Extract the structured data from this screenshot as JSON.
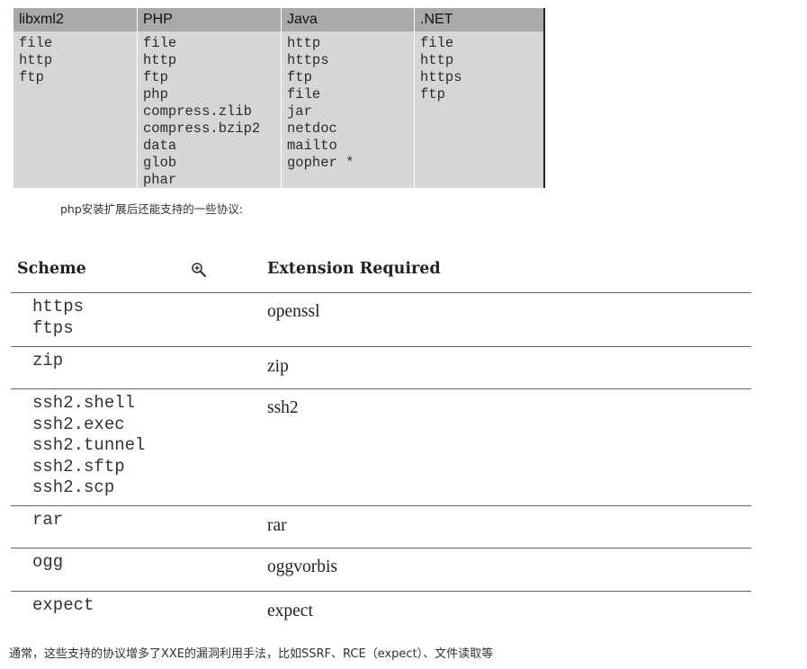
{
  "protocol_table": {
    "headers": [
      "libxml2",
      "PHP",
      "Java",
      ".NET"
    ],
    "columns": [
      [
        "file",
        "http",
        "ftp"
      ],
      [
        "file",
        "http",
        "ftp",
        "php",
        "compress.zlib",
        "compress.bzip2",
        "data",
        "glob",
        "phar"
      ],
      [
        "http",
        "https",
        "ftp",
        "file",
        "jar",
        "netdoc",
        "mailto",
        "gopher *"
      ],
      [
        "file",
        "http",
        "https",
        "ftp"
      ]
    ]
  },
  "caption": "php安装扩展后还能支持的一些协议:",
  "scheme_table": {
    "header_scheme": "Scheme",
    "header_extension": "Extension Required",
    "zoom_icon": "zoom-in-icon",
    "rows": [
      {
        "schemes": [
          "https",
          "ftps"
        ],
        "extension": "openssl"
      },
      {
        "schemes": [
          "zip"
        ],
        "extension": "zip"
      },
      {
        "schemes": [
          "ssh2.shell",
          "ssh2.exec",
          "ssh2.tunnel",
          "ssh2.sftp",
          "ssh2.scp"
        ],
        "extension": "ssh2"
      },
      {
        "schemes": [
          "rar"
        ],
        "extension": "rar"
      },
      {
        "schemes": [
          "ogg"
        ],
        "extension": "oggvorbis"
      },
      {
        "schemes": [
          "expect"
        ],
        "extension": "expect"
      }
    ]
  },
  "footer": "通常，这些支持的协议增多了XXE的漏洞利用手法，比如SSRF、RCE（expect）、文件读取等"
}
